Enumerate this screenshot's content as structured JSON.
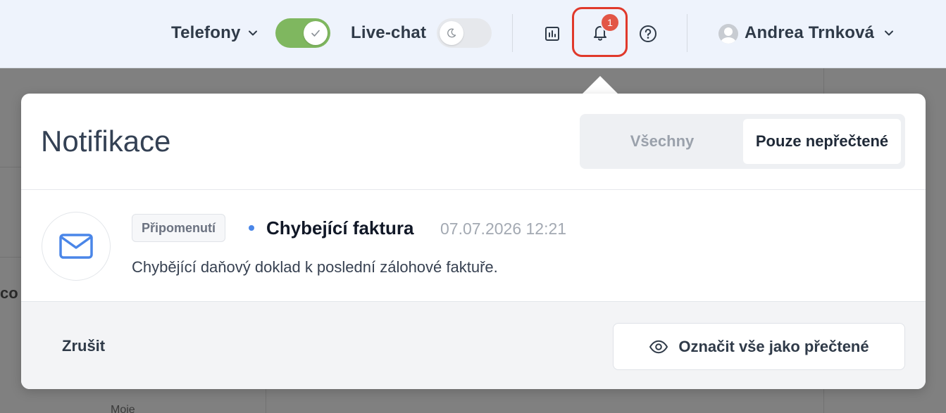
{
  "topbar": {
    "phones_label": "Telefony",
    "phones_toggle_on": true,
    "livechat_label": "Live-chat",
    "livechat_toggle_on": false,
    "notification_count": "1",
    "user_name": "Andrea Trnková"
  },
  "background": {
    "partial_text_left": "co",
    "partial_text_bottom": "Moje"
  },
  "popup": {
    "title": "Notifikace",
    "filter": {
      "all_label": "Všechny",
      "unread_label": "Pouze nepřečtené",
      "selected": "unread"
    },
    "notifications": [
      {
        "tag": "Připomenutí",
        "title": "Chybející faktura",
        "time": "07.07.2026 12:21",
        "body": "Chybějící daňový doklad k poslední zálohové faktuře.",
        "icon": "envelope-icon",
        "unread": true
      }
    ],
    "footer": {
      "cancel_label": "Zrušit",
      "mark_all_label": "Označit vše jako přečtené"
    }
  },
  "colors": {
    "accent_blue": "#4a86e8",
    "toggle_on": "#7fb75f",
    "badge_red": "#e25646",
    "highlight_red": "#e0392b",
    "topbar_bg": "#eef3fc"
  }
}
